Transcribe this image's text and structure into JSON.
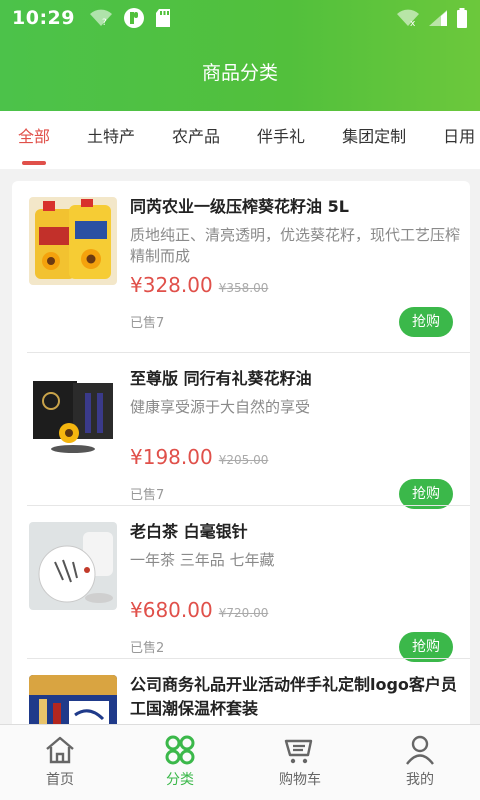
{
  "status_bar": {
    "time": "10:29"
  },
  "header": {
    "title": "商品分类"
  },
  "category_tabs": [
    {
      "label": "全部",
      "active": true
    },
    {
      "label": "土特产",
      "active": false
    },
    {
      "label": "农产品",
      "active": false
    },
    {
      "label": "伴手礼",
      "active": false
    },
    {
      "label": "集团定制",
      "active": false
    },
    {
      "label": "日用",
      "active": false
    }
  ],
  "products": [
    {
      "name": "同芮农业一级压榨葵花籽油 5L",
      "desc": "质地纯正、清亮透明，优选葵花籽，现代工艺压榨精制而成",
      "price": "¥328.00",
      "original_price": "¥358.00",
      "sold": "已售7",
      "buy_label": "抢购",
      "image_icon": "sunflower-oil-bottles"
    },
    {
      "name": "至尊版 同行有礼葵花籽油",
      "desc": "健康享受源于大自然的享受",
      "price": "¥198.00",
      "original_price": "¥205.00",
      "sold": "已售7",
      "buy_label": "抢购",
      "image_icon": "gift-box-oil"
    },
    {
      "name": "老白茶 白毫银针",
      "desc": "一年茶 三年品 七年藏",
      "price": "¥680.00",
      "original_price": "¥720.00",
      "sold": "已售2",
      "buy_label": "抢购",
      "image_icon": "tea-cake"
    },
    {
      "name": "公司商务礼品开业活动伴手礼定制logo客户员工国潮保温杯套装",
      "desc": "",
      "price": "",
      "original_price": "",
      "sold": "",
      "buy_label": "",
      "image_icon": "thermos-gift-set"
    }
  ],
  "bottom_nav": [
    {
      "label": "首页",
      "icon": "home-icon",
      "active": false
    },
    {
      "label": "分类",
      "icon": "category-icon",
      "active": true
    },
    {
      "label": "购物车",
      "icon": "cart-icon",
      "active": false
    },
    {
      "label": "我的",
      "icon": "user-icon",
      "active": false
    }
  ],
  "colors": {
    "header_green": "#4cc24a",
    "accent_red": "#e0504a",
    "buy_green": "#3bb84a"
  }
}
